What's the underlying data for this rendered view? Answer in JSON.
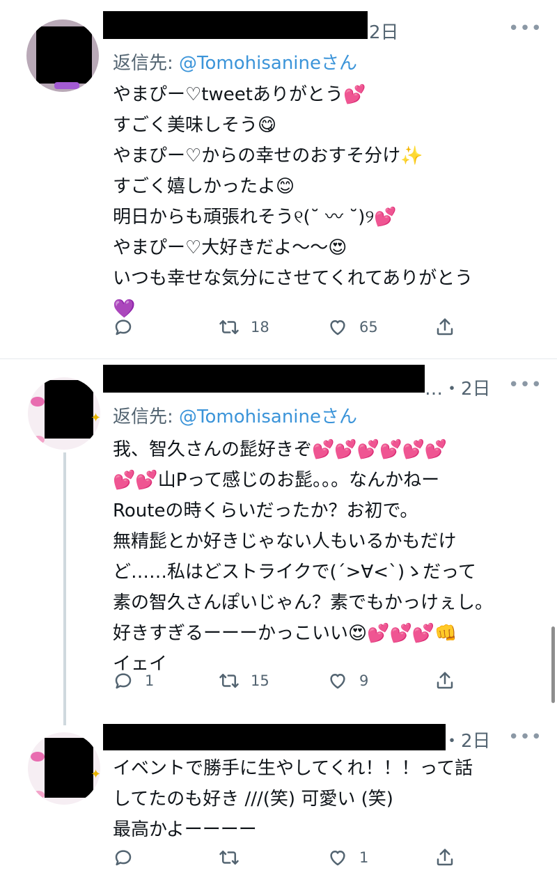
{
  "tweets": [
    {
      "time": "2日",
      "more": "•••",
      "reply_prefix": "返信先: ",
      "reply_handle": "@Tomohisanine",
      "reply_suffix": "さん",
      "lines": [
        "やまぴー♡tweetありがとう💕",
        "すごく美味しそう😋",
        "やまぴー♡からの幸せのおすそ分け✨",
        "すごく嬉しかったよ😊",
        "明日からも頑張れそう୧(˘ 〰 ˘)୨💕",
        "やまぴー♡大好きだよ〜〜😍",
        "いつも幸せな気分にさせてくれてありがとう",
        "💜"
      ],
      "reply_count": "",
      "retweet_count": "18",
      "like_count": "65"
    },
    {
      "time": "…・2日",
      "more": "•••",
      "reply_prefix": "返信先: ",
      "reply_handle": "@Tomohisanine",
      "reply_suffix": "さん",
      "lines": [
        "我、智久さんの髭好きぞ💕💕💕💕💕💕",
        "💕💕山Pって感じのお髭。。。なんかねー",
        "Routeの時くらいだったか？お初で。",
        "無精髭とか好きじゃない人もいるかもだけ",
        "ど……私はどストライクで(´>∀<`)ゝだって",
        "素の智久さんぽいじゃん？素でもかっけぇし。",
        "好きすぎるーーーかっこいい😍💕💕💕👊",
        "イェイ"
      ],
      "reply_count": "1",
      "retweet_count": "15",
      "like_count": "9"
    },
    {
      "time": "・2日",
      "more": "•••",
      "lines": [
        "イベントで勝手に生やしてくれ！！！って話",
        "してたのも好き ///(笑) 可愛い (笑)",
        "最高かよーーーー"
      ],
      "reply_count": "",
      "retweet_count": "",
      "like_count": "1"
    }
  ],
  "icons": {
    "reply": "reply-icon",
    "retweet": "retweet-icon",
    "like": "heart-icon",
    "share": "share-icon",
    "more": "more-icon"
  },
  "colors": {
    "handle_link": "#3b94d9",
    "secondary_text": "#536471",
    "divider": "#e6e9ec"
  }
}
